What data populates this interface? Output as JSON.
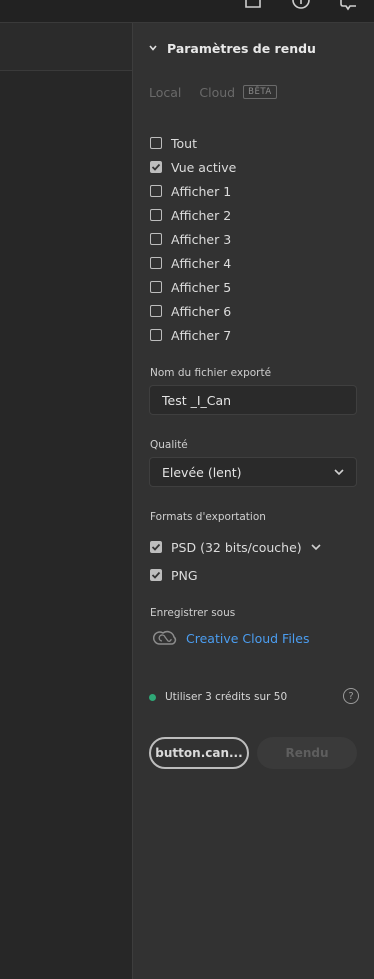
{
  "panel": {
    "section_title": "Paramètres de rendu",
    "tabs": [
      {
        "label": "Local"
      },
      {
        "label": "Cloud",
        "badge": "BÊTA"
      }
    ],
    "views": [
      {
        "label": "Tout",
        "checked": false
      },
      {
        "label": "Vue active",
        "checked": true
      },
      {
        "label": "Afficher 1",
        "checked": false
      },
      {
        "label": "Afficher 2",
        "checked": false
      },
      {
        "label": "Afficher 3",
        "checked": false
      },
      {
        "label": "Afficher 4",
        "checked": false
      },
      {
        "label": "Afficher 5",
        "checked": false
      },
      {
        "label": "Afficher 6",
        "checked": false
      },
      {
        "label": "Afficher 7",
        "checked": false
      }
    ],
    "filename": {
      "label": "Nom du fichier exporté",
      "value": "Test _I_Can"
    },
    "quality": {
      "label": "Qualité",
      "selected": "Elevée (lent)"
    },
    "formats": {
      "label": "Formats d'exportation",
      "items": [
        {
          "label": "PSD (32 bits/couche)",
          "checked": true
        },
        {
          "label": "PNG",
          "checked": true
        }
      ]
    },
    "save": {
      "label": "Enregistrer sous",
      "destination": "Creative Cloud Files"
    },
    "credits": {
      "text": "Utiliser 3 crédits sur 50",
      "help": "?"
    },
    "buttons": {
      "cancel": "button.can...",
      "render": "Rendu"
    }
  },
  "colors": {
    "accent_link": "#4b9df0",
    "status_dot": "#2fa877"
  }
}
